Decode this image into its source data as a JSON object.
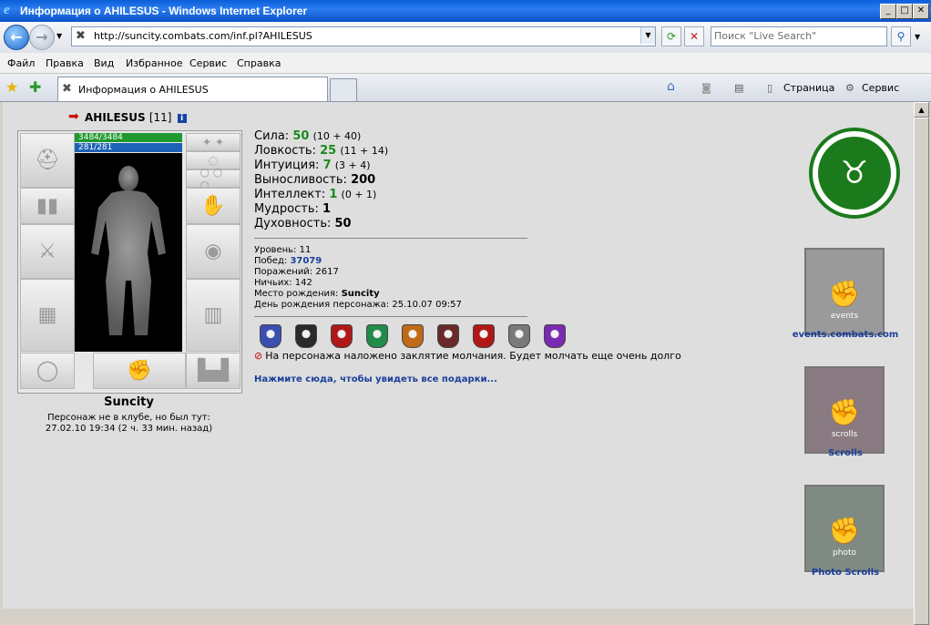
{
  "window": {
    "title": "Информация о AHILESUS - Windows Internet Explorer"
  },
  "nav": {
    "url": "http://suncity.combats.com/inf.pl?AHILESUS",
    "search_placeholder": "Поиск \"Live Search\""
  },
  "menu": [
    "Файл",
    "Правка",
    "Вид",
    "Избранное",
    "Сервис",
    "Справка"
  ],
  "tab": {
    "title": "Информация о AHILESUS"
  },
  "commands": {
    "page": "Страница",
    "tools": "Сервис"
  },
  "character": {
    "name": "AHILESUS",
    "level_tag": "[11]",
    "hp": "3484/3484",
    "mana": "281/281",
    "city": "Suncity",
    "offline_line1": "Персонаж не в клубе, но был тут:",
    "offline_line2": "27.02.10 19:34 (2 ч. 33 мин. назад)"
  },
  "stats": [
    {
      "label": "Сила:",
      "value": "50",
      "bonus": "(10 + 40)",
      "green": true
    },
    {
      "label": "Ловкость:",
      "value": "25",
      "bonus": "(11 + 14)",
      "green": true
    },
    {
      "label": "Интуиция:",
      "value": "7",
      "bonus": "(3 + 4)",
      "green": true
    },
    {
      "label": "Выносливость:",
      "value": "200",
      "bonus": "",
      "green": false
    },
    {
      "label": "Интеллект:",
      "value": "1",
      "bonus": "(0 + 1)",
      "green": true
    },
    {
      "label": "Мудрость:",
      "value": "1",
      "bonus": "",
      "green": false
    },
    {
      "label": "Духовность:",
      "value": "50",
      "bonus": "",
      "green": false
    }
  ],
  "info": {
    "level_label": "Уровень:",
    "level": "11",
    "wins_label": "Побед:",
    "wins": "37079",
    "losses_label": "Поражений:",
    "losses": "2617",
    "draws_label": "Ничьих:",
    "draws": "142",
    "birthplace_label": "Место рождения:",
    "birthplace": "Suncity",
    "birthday_label": "День рождения персонажа:",
    "birthday": "25.10.07 09:57"
  },
  "silence": "На персонажа наложено заклятие молчания. Будет молчать еще очень долго",
  "gifts_link": "Нажмите сюда, чтобы увидеть все подарки...",
  "badge_colors": [
    "#3a4fb0",
    "#2a2a2a",
    "#b01818",
    "#1f8c4a",
    "#c06a18",
    "#6a2a2a",
    "#b01818",
    "#7a7a7a",
    "#7a2ab0"
  ],
  "sidebar": {
    "events_word": "events",
    "events_link": "events.combats.com",
    "scrolls_word": "scrolls",
    "scrolls_link": "Scrolls",
    "photo_word": "photo",
    "photo_link": "Photo Scrolls"
  }
}
